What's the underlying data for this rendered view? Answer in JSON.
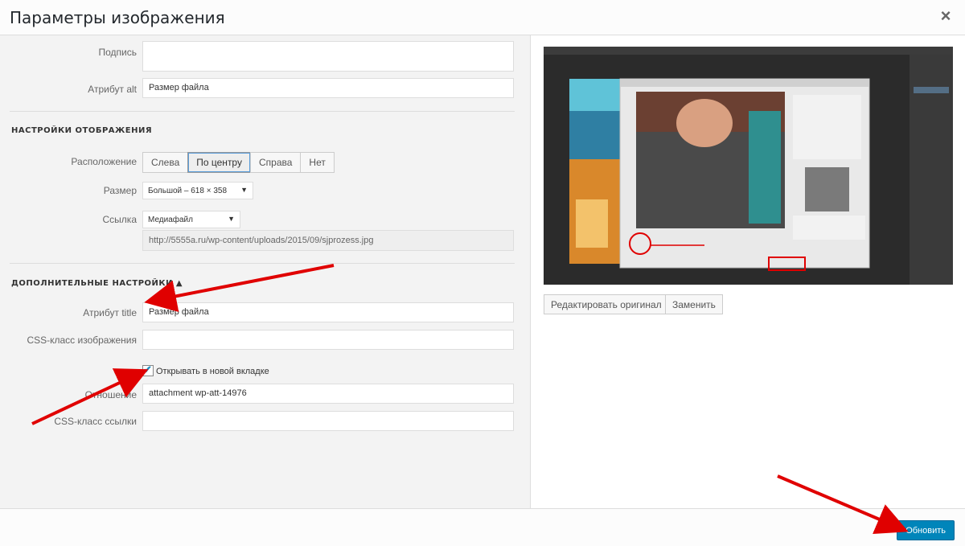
{
  "title": "Параметры изображения",
  "close_label": "×",
  "caption_label": "Подпись",
  "alt_label": "Атрибут alt",
  "alt_value": "Размер файла",
  "display_section": "НАСТРОЙКИ ОТОБРАЖЕНИЯ",
  "align_label": "Расположение",
  "align_options": [
    "Слева",
    "По центру",
    "Справа",
    "Нет"
  ],
  "size_label": "Размер",
  "size_value": "Большой – 618 × 358",
  "link_label": "Ссылка",
  "link_value": "Медиафайл",
  "link_url": "http://5555a.ru/wp-content/uploads/2015/09/sjprozess.jpg",
  "advanced_section": "ДОПОЛНИТЕЛЬНЫЕ НАСТРОЙКИ ▲",
  "title_attr_label": "Атрибут title",
  "title_attr_value": "Размер файла",
  "css_image_label": "CSS-класс изображения",
  "new_tab_label": "Открывать в новой вкладке",
  "rel_label": "Отношение",
  "rel_value": "attachment wp-att-14976",
  "css_link_label": "CSS-класс ссылки",
  "edit_original": "Редактировать оригинал",
  "replace": "Заменить",
  "update": "Обновить",
  "colors": {
    "accent": "#0085ba",
    "arrow": "#e00000"
  }
}
